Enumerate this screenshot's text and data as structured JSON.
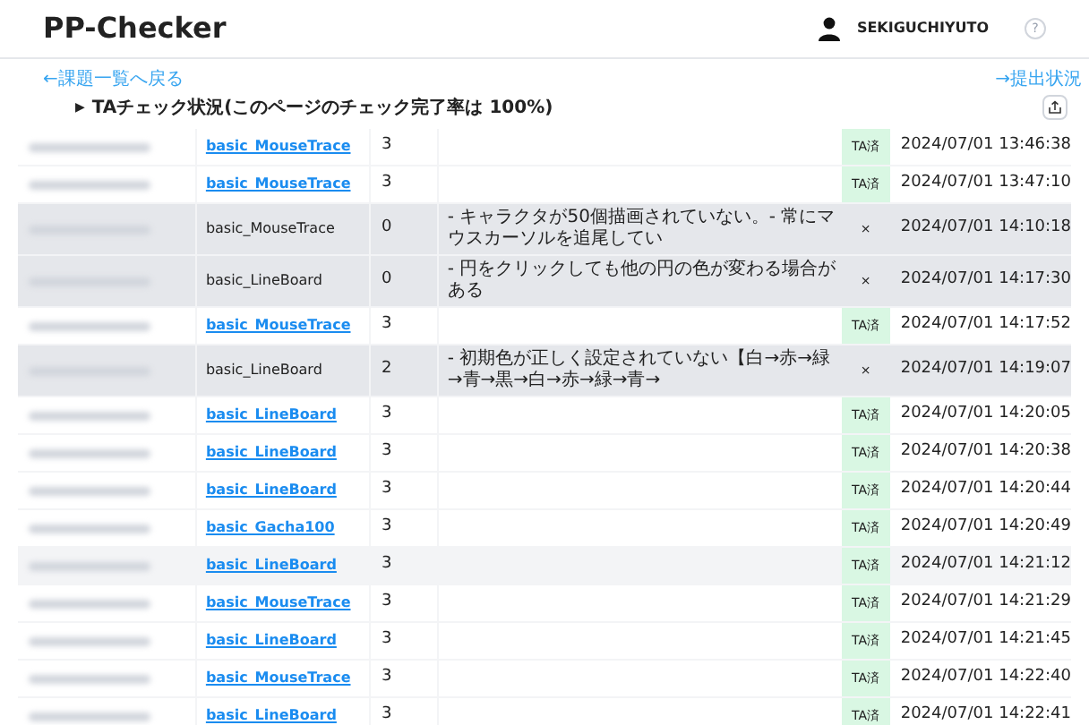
{
  "header": {
    "title": "PP-Checker",
    "user": "SEKIGUCHIYUTO",
    "help": "?"
  },
  "nav": {
    "back_link": "←課題一覧へ戻る",
    "submit_link": "→提出状況"
  },
  "summary": {
    "toggle": "▶",
    "label": "TAチェック状況(このページのチェック完了率は 100%)"
  },
  "rows": [
    {
      "task": "basic_MouseTrace",
      "linked": true,
      "score": "3",
      "comment": "",
      "status": "TA済",
      "passed": true,
      "highlighted": false,
      "time": "2024/07/01 13:46:38"
    },
    {
      "task": "basic_MouseTrace",
      "linked": true,
      "score": "3",
      "comment": "",
      "status": "TA済",
      "passed": true,
      "highlighted": false,
      "time": "2024/07/01 13:47:10"
    },
    {
      "task": "basic_MouseTrace",
      "linked": false,
      "score": "0",
      "comment": "- キャラクタが50個描画されていない。- 常にマウスカーソルを追尾してい",
      "status": "×",
      "passed": false,
      "highlighted": false,
      "time": "2024/07/01 14:10:18"
    },
    {
      "task": "basic_LineBoard",
      "linked": false,
      "score": "0",
      "comment": "- 円をクリックしても他の円の色が変わる場合がある",
      "status": "×",
      "passed": false,
      "highlighted": false,
      "time": "2024/07/01 14:17:30"
    },
    {
      "task": "basic_MouseTrace",
      "linked": true,
      "score": "3",
      "comment": "",
      "status": "TA済",
      "passed": true,
      "highlighted": false,
      "time": "2024/07/01 14:17:52"
    },
    {
      "task": "basic_LineBoard",
      "linked": false,
      "score": "2",
      "comment": "- 初期色が正しく設定されていない【白→赤→緑→青→黒→白→赤→緑→青→",
      "status": "×",
      "passed": false,
      "highlighted": false,
      "time": "2024/07/01 14:19:07"
    },
    {
      "task": "basic_LineBoard",
      "linked": true,
      "score": "3",
      "comment": "",
      "status": "TA済",
      "passed": true,
      "highlighted": false,
      "time": "2024/07/01 14:20:05"
    },
    {
      "task": "basic_LineBoard",
      "linked": true,
      "score": "3",
      "comment": "",
      "status": "TA済",
      "passed": true,
      "highlighted": false,
      "time": "2024/07/01 14:20:38"
    },
    {
      "task": "basic_LineBoard",
      "linked": true,
      "score": "3",
      "comment": "",
      "status": "TA済",
      "passed": true,
      "highlighted": false,
      "time": "2024/07/01 14:20:44"
    },
    {
      "task": "basic_Gacha100",
      "linked": true,
      "score": "3",
      "comment": "",
      "status": "TA済",
      "passed": true,
      "highlighted": false,
      "time": "2024/07/01 14:20:49"
    },
    {
      "task": "basic_LineBoard",
      "linked": true,
      "score": "3",
      "comment": "",
      "status": "TA済",
      "passed": true,
      "highlighted": true,
      "time": "2024/07/01 14:21:12"
    },
    {
      "task": "basic_MouseTrace",
      "linked": true,
      "score": "3",
      "comment": "",
      "status": "TA済",
      "passed": true,
      "highlighted": false,
      "time": "2024/07/01 14:21:29"
    },
    {
      "task": "basic_LineBoard",
      "linked": true,
      "score": "3",
      "comment": "",
      "status": "TA済",
      "passed": true,
      "highlighted": false,
      "time": "2024/07/01 14:21:45"
    },
    {
      "task": "basic_MouseTrace",
      "linked": true,
      "score": "3",
      "comment": "",
      "status": "TA済",
      "passed": true,
      "highlighted": false,
      "time": "2024/07/01 14:22:40"
    },
    {
      "task": "basic_LineBoard",
      "linked": true,
      "score": "3",
      "comment": "",
      "status": "TA済",
      "passed": true,
      "highlighted": false,
      "time": "2024/07/01 14:22:41"
    }
  ]
}
